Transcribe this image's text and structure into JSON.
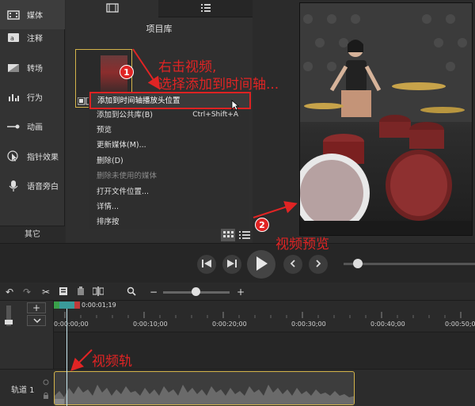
{
  "sidebar": {
    "items": [
      {
        "label": "媒体",
        "icon": "media-icon"
      },
      {
        "label": "注释",
        "icon": "annotation-icon"
      },
      {
        "label": "转场",
        "icon": "transition-icon"
      },
      {
        "label": "行为",
        "icon": "behavior-icon"
      },
      {
        "label": "动画",
        "icon": "animation-icon"
      },
      {
        "label": "指针效果",
        "icon": "cursor-effect-icon"
      },
      {
        "label": "语音旁白",
        "icon": "microphone-icon"
      }
    ],
    "other_label": "其它",
    "add_label": "+"
  },
  "library": {
    "title": "项目库"
  },
  "context_menu": {
    "items": [
      {
        "label": "添加到时间轴播放头位置",
        "shortcut": "",
        "disabled": false
      },
      {
        "label": "添加到公共库(B)",
        "shortcut": "Ctrl+Shift+A",
        "disabled": false
      },
      {
        "label": "预览",
        "shortcut": "",
        "disabled": false
      },
      {
        "label": "更新媒体(M)...",
        "shortcut": "",
        "disabled": false
      },
      {
        "label": "删除(D)",
        "shortcut": "",
        "disabled": false
      },
      {
        "label": "删除未使用的媒体",
        "shortcut": "",
        "disabled": true
      },
      {
        "label": "打开文件位置...",
        "shortcut": "",
        "disabled": false
      },
      {
        "label": "详情...",
        "shortcut": "",
        "disabled": false
      },
      {
        "label": "排序按",
        "shortcut": "",
        "disabled": false
      }
    ]
  },
  "timeline": {
    "playhead_time": "0:00:01;19",
    "ticks": [
      "0:00:00;00",
      "0:00:10;00",
      "0:00:20;00",
      "0:00:30;00",
      "0:00:40;00",
      "0:00:50;00"
    ],
    "track_label": "轨道 1",
    "zoom_minus": "−",
    "zoom_plus": "+"
  },
  "annotations": {
    "step1_badge": "1",
    "step1_line1": "右击视频,",
    "step1_line2": "选择添加到时间轴...",
    "step2_badge": "2",
    "step2_text": "视频预览",
    "track_text": "视频轨"
  },
  "colors": {
    "highlight": "#e02424",
    "clip_border": "#d4b44a",
    "playhead": "#3a9a9a"
  }
}
